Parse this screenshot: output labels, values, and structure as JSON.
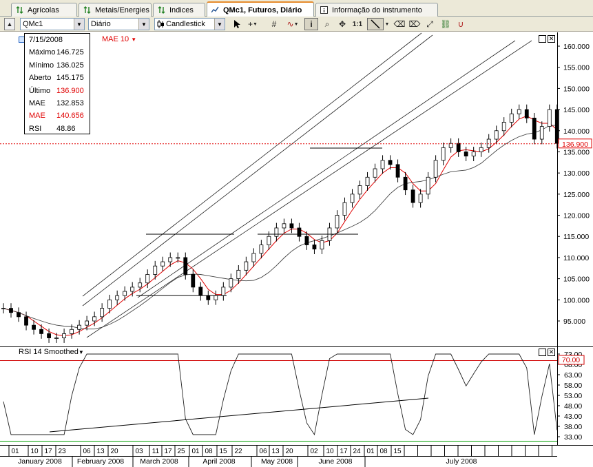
{
  "tabs": [
    {
      "label": "Agrícolas",
      "icon": "up-down-arrow-icon"
    },
    {
      "label": "Metais/Energies",
      "icon": "up-down-arrow-icon"
    },
    {
      "label": "Indices",
      "icon": "up-down-arrow-icon"
    },
    {
      "label": "QMc1, Futuros, Diário",
      "icon": "chart-line-icon",
      "active": true
    },
    {
      "label": "Informação do instrumento",
      "icon": "info-icon"
    }
  ],
  "toolbar": {
    "symbol": "QMc1",
    "interval": "Diário",
    "chart_type": "Candlestick",
    "zoom_label": "1:1"
  },
  "info": {
    "date": "7/15/2008",
    "rows": [
      {
        "label": "Máximo",
        "value": "146.725"
      },
      {
        "label": "Mínimo",
        "value": "136.025"
      },
      {
        "label": "Aberto",
        "value": "145.175"
      },
      {
        "label": "Último",
        "value": "136.900"
      },
      {
        "label": "MAE",
        "value": "132.853"
      },
      {
        "label": "MAE",
        "value": "140.656"
      },
      {
        "label": "RSI",
        "value": "48.86"
      }
    ]
  },
  "indicator_labels": {
    "mae": "MAE 10",
    "rsi": "RSI 14 Smoothed"
  },
  "price_axis": {
    "ticks": [
      "160.000",
      "155.000",
      "150.000",
      "145.000",
      "140.000",
      "135.000",
      "130.000",
      "125.000",
      "120.000",
      "115.000",
      "110.000",
      "105.000",
      "100.000",
      "95.000"
    ],
    "last_price": "136.900"
  },
  "rsi_axis": {
    "ticks": [
      "73.00",
      "68.00",
      "63.00",
      "58.00",
      "53.00",
      "48.00",
      "43.00",
      "38.00",
      "33.00"
    ],
    "level": "70.00"
  },
  "date_axis": {
    "days": [
      "01",
      "10",
      "17",
      "23",
      "06",
      "13",
      "20",
      "03",
      "11",
      "17",
      "25",
      "01",
      "08",
      "15",
      "22",
      "06",
      "13",
      "20",
      "02",
      "10",
      "17",
      "24",
      "01",
      "08",
      "15"
    ],
    "months": [
      "January 2008",
      "February 2008",
      "March 2008",
      "April 2008",
      "May 2008",
      "June 2008",
      "July 2008"
    ]
  },
  "colors": {
    "candle_up": "#ffffff",
    "candle_down": "#000000",
    "mae_line": "#e00000",
    "last_price_line": "#e00000",
    "rsi_level": "#d00000",
    "rsi_lower": "#00a000",
    "panel_bg": "#ffffff",
    "chrome": "#ece9d8"
  },
  "chart_data": {
    "type": "candlestick",
    "symbol": "QMc1",
    "interval": "Diário",
    "series_close_approx": [
      98,
      97,
      96,
      94,
      93,
      92,
      91,
      91,
      92,
      93,
      94,
      95,
      96,
      98,
      100,
      101,
      102,
      103,
      104,
      106,
      108,
      109,
      110,
      110,
      106,
      103,
      101,
      100,
      101,
      103,
      105,
      107,
      109,
      111,
      113,
      115,
      117,
      118,
      117,
      115,
      113,
      112,
      114,
      117,
      120,
      123,
      125,
      127,
      129,
      131,
      133,
      132,
      129,
      126,
      123,
      125,
      129,
      133,
      136,
      137,
      135,
      134,
      135,
      136,
      138,
      140,
      142,
      144,
      145,
      143,
      138,
      141,
      145,
      137
    ],
    "last": 136.9,
    "ylim": [
      90,
      162
    ],
    "rsi_ylim": [
      30,
      75
    ]
  }
}
